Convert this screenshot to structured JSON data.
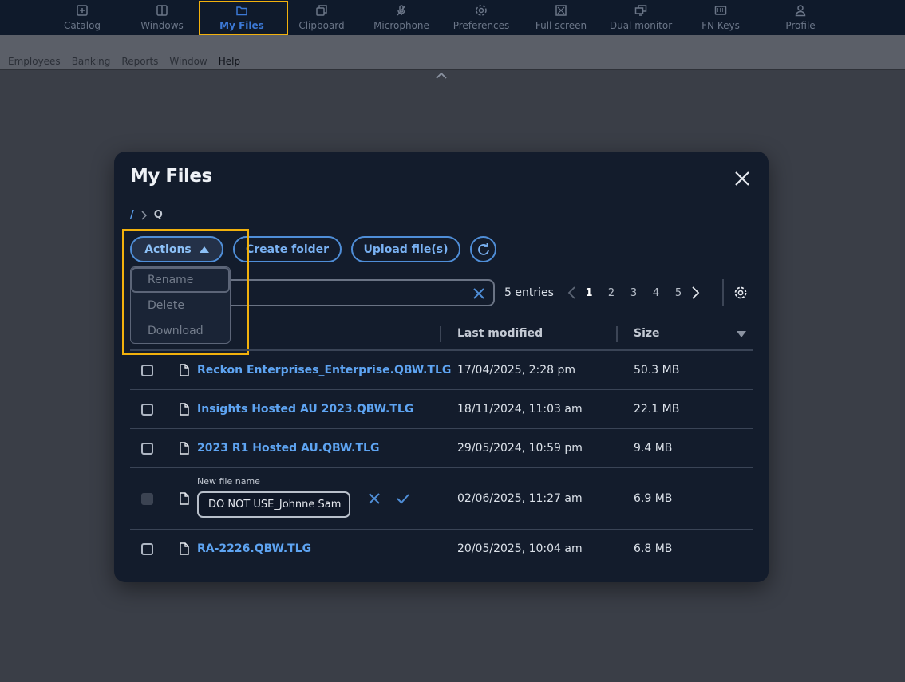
{
  "toolbar": {
    "items": [
      {
        "label": "Catalog",
        "icon": "plus-square-icon"
      },
      {
        "label": "Windows",
        "icon": "window-icon"
      },
      {
        "label": "My Files",
        "icon": "folder-icon",
        "active": true
      },
      {
        "label": "Clipboard",
        "icon": "clipboard-icon"
      },
      {
        "label": "Microphone",
        "icon": "microphone-off-icon"
      },
      {
        "label": "Preferences",
        "icon": "gear-icon"
      },
      {
        "label": "Full screen",
        "icon": "fullscreen-icon"
      },
      {
        "label": "Dual monitor",
        "icon": "dual-monitor-icon"
      },
      {
        "label": "FN Keys",
        "icon": "keyboard-icon"
      },
      {
        "label": "Profile",
        "icon": "user-icon"
      }
    ],
    "highlight_color": "#f2b10d"
  },
  "menubar": {
    "items": [
      "Employees",
      "Banking",
      "Reports",
      "Window",
      "Help"
    ]
  },
  "dialog": {
    "title": "My Files",
    "breadcrumb": {
      "root": "/",
      "current": "Q"
    },
    "buttons": {
      "actions": "Actions",
      "create_folder": "Create folder",
      "upload": "Upload file(s)"
    },
    "actions_menu": [
      "Rename",
      "Delete",
      "Download"
    ],
    "entries": "5 entries",
    "pages": [
      "1",
      "2",
      "3",
      "4",
      "5"
    ],
    "current_page": "1",
    "columns": {
      "modified": "Last modified",
      "size": "Size"
    },
    "rows": [
      {
        "name": "Reckon Enterprises_Enterprise.QBW.TLG",
        "modified": "17/04/2025, 2:28 pm",
        "size": "50.3 MB"
      },
      {
        "name": "Insights Hosted AU 2023.QBW.TLG",
        "modified": "18/11/2024, 11:03 am",
        "size": "22.1 MB"
      },
      {
        "name": "2023 R1 Hosted AU.QBW.TLG",
        "modified": "29/05/2024, 10:59 pm",
        "size": "9.4 MB"
      },
      {
        "name": "",
        "modified": "02/06/2025, 11:27 am",
        "size": "6.9 MB",
        "rename_label": "New file name",
        "rename_value": "DO NOT USE_Johnne Sam"
      },
      {
        "name": "RA-2226.QBW.TLG",
        "modified": "20/05/2025, 10:04 am",
        "size": "6.8 MB"
      }
    ],
    "accent_color": "#5ea4f2"
  }
}
